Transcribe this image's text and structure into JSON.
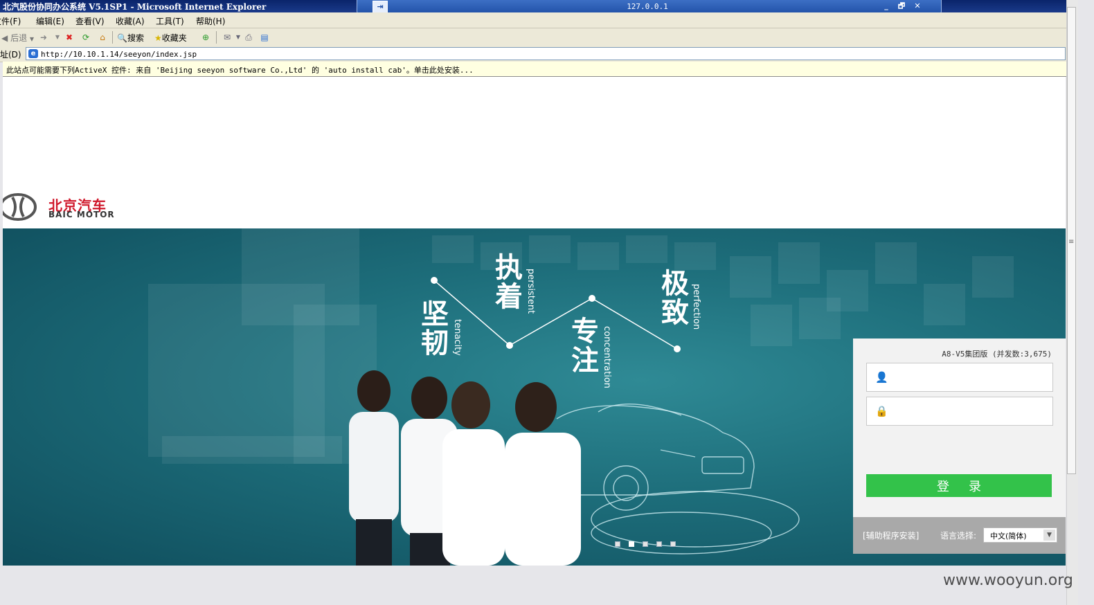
{
  "window": {
    "title": "北汽股份协同办公系统 V5.1SP1 - Microsoft Internet Explorer",
    "remote_host": "127.0.0.1",
    "controls": {
      "minimize": "_",
      "restore": "🗗",
      "close": "✕"
    }
  },
  "menu": [
    "文件(F)",
    "编辑(E)",
    "查看(V)",
    "收藏(A)",
    "工具(T)",
    "帮助(H)"
  ],
  "toolbar": {
    "back_label": "后退",
    "search_label": "搜索",
    "favorites_label": "收藏夹"
  },
  "address": {
    "label": "地址(D)",
    "url": "http://10.10.1.14/seeyon/index.jsp"
  },
  "infobar": {
    "text": "此站点可能需要下列ActiveX 控件: 来自 'Beijing seeyon software Co.,Ltd' 的 'auto install cab'。单击此处安装..."
  },
  "brand": {
    "name_cn": "北京汽车",
    "name_en": "BAIC MOTOR",
    "logo_color": "#d0182b"
  },
  "banner": {
    "slogans": [
      {
        "cn": "坚韧",
        "en": "tenacity"
      },
      {
        "cn": "执着",
        "en": "persistent"
      },
      {
        "cn": "专注",
        "en": "concentration"
      },
      {
        "cn": "极致",
        "en": "perfection"
      }
    ],
    "slide_count": 5,
    "active_slide": 1
  },
  "login": {
    "edition": "A8-V5集团版 (并发数:3,675)",
    "username_value": "",
    "password_value": "",
    "submit_label": "登录",
    "helper_link": "[辅助程序安装]",
    "language_label": "语言选择:",
    "language_value": "中文(简体)",
    "button_color": "#33c24a"
  },
  "watermark": "www.wooyun.org"
}
